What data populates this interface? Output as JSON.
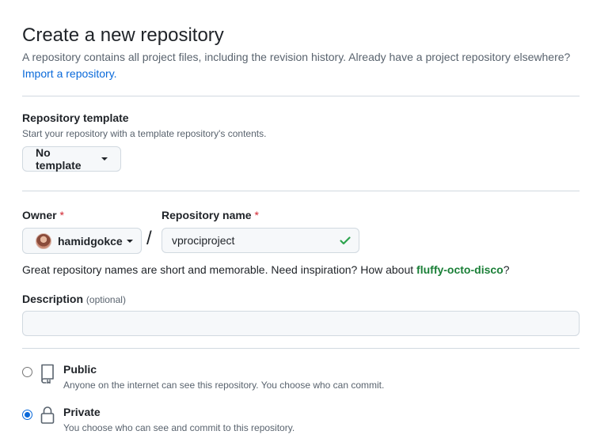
{
  "header": {
    "title": "Create a new repository",
    "subtitle": "A repository contains all project files, including the revision history. Already have a project repository elsewhere?",
    "import_link": "Import a repository."
  },
  "template": {
    "label": "Repository template",
    "note": "Start your repository with a template repository's contents.",
    "button": "No template"
  },
  "owner": {
    "label": "Owner",
    "required_mark": "*",
    "value": "hamidgokce"
  },
  "separator": "/",
  "repo_name": {
    "label": "Repository name",
    "required_mark": "*",
    "value": "vprociproject",
    "valid_icon": "check-icon",
    "valid_color": "#1a7f37"
  },
  "name_hint": {
    "text": "Great repository names are short and memorable. Need inspiration? How about ",
    "suggestion": "fluffy-octo-disco",
    "end": "?"
  },
  "description": {
    "label": "Description",
    "optional": "(optional)",
    "value": ""
  },
  "visibility": {
    "public": {
      "title": "Public",
      "desc": "Anyone on the internet can see this repository. You choose who can commit.",
      "icon": "repo-icon",
      "selected": false
    },
    "private": {
      "title": "Private",
      "desc": "You choose who can see and commit to this repository.",
      "icon": "lock-icon",
      "selected": true
    }
  },
  "colors": {
    "link": "#0969da",
    "required": "#d1242f",
    "accent": "#0969da"
  }
}
